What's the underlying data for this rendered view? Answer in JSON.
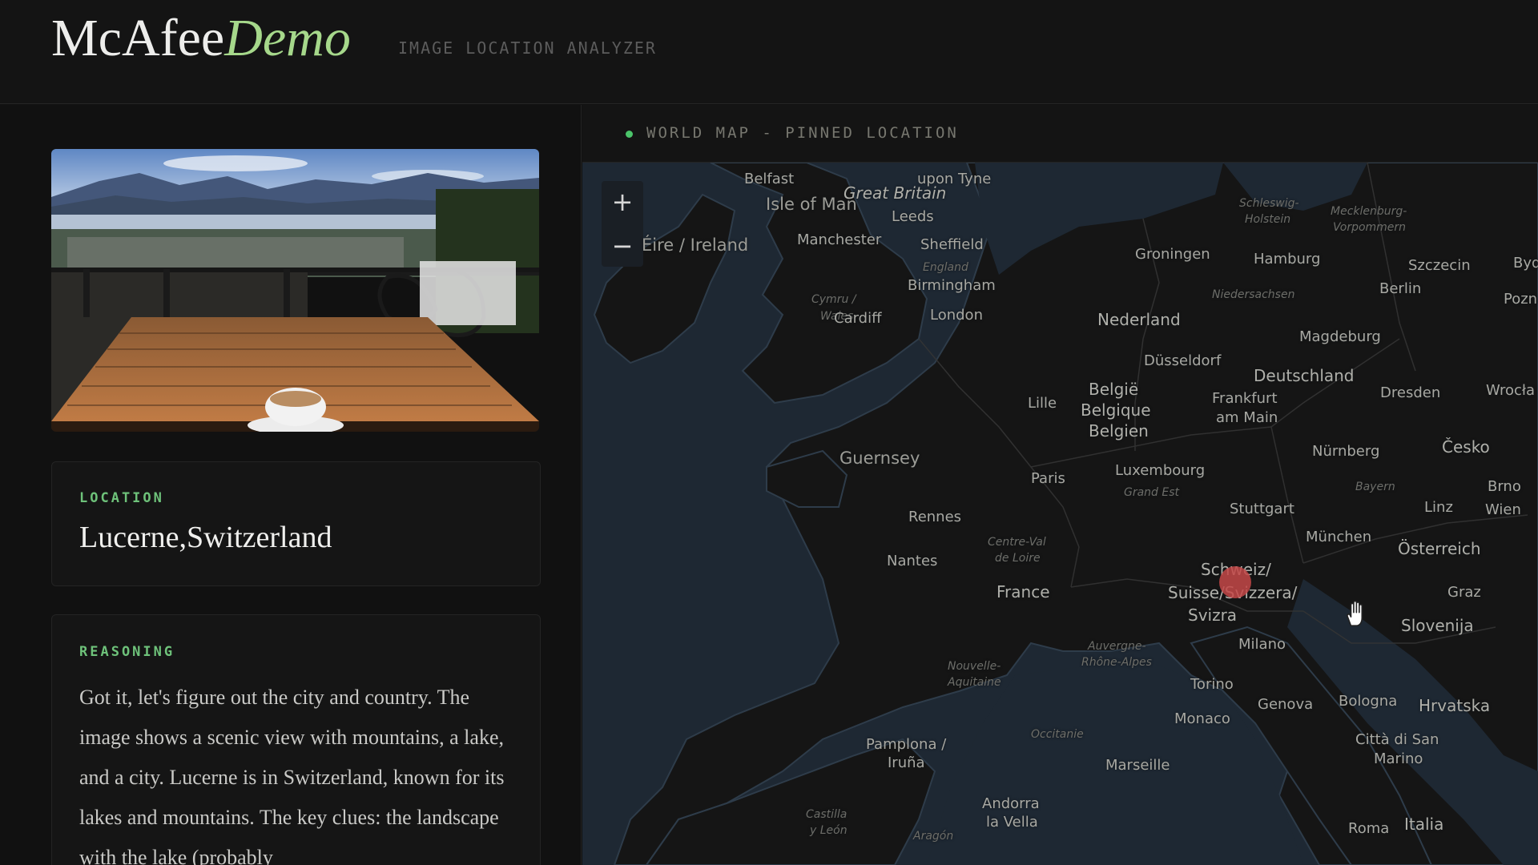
{
  "header": {
    "brand_main": "McAfee",
    "brand_accent": "Demo",
    "subtitle": "IMAGE LOCATION ANALYZER"
  },
  "location_card": {
    "label": "LOCATION",
    "value": "Lucerne,Switzerland"
  },
  "reasoning_card": {
    "label": "REASONING",
    "text": "Got it, let's figure out the city and country. The image shows a scenic view with mountains, a lake, and a city. Lucerne is in Switzerland, known for its lakes and mountains. The key clues: the landscape with the lake (probably"
  },
  "map": {
    "title": "WORLD MAP - PINNED LOCATION",
    "zoom_in": "+",
    "zoom_out": "−",
    "labels": {
      "belfast": "Belfast",
      "isle_of_man": "Isle of Man",
      "great_britain": "Great Britain",
      "upon_tyne": "upon Tyne",
      "leeds": "Leeds",
      "eire": "Éire / Ireland",
      "manchester": "Manchester",
      "sheffield": "Sheffield",
      "england": "England",
      "cymru": "Cymru /",
      "wales": "Wales",
      "birmingham": "Birmingham",
      "cardiff": "Cardiff",
      "london": "London",
      "guernsey": "Guernsey",
      "rennes": "Rennes",
      "nantes": "Nantes",
      "centre_val": "Centre-Val",
      "de_loire": "de Loire",
      "paris": "Paris",
      "france": "France",
      "lille": "Lille",
      "nederland": "Nederland",
      "groningen": "Groningen",
      "belgie": "België",
      "belgique": "Belgique",
      "belgien": "Belgien",
      "luxembourg": "Luxembourg",
      "grand_est": "Grand Est",
      "dusseldorf": "Düsseldorf",
      "frankfurt": "Frankfurt",
      "am_main": "am Main",
      "deutschland": "Deutschland",
      "hamburg": "Hamburg",
      "niedersachsen": "Niedersachsen",
      "berlin": "Berlin",
      "magdeburg": "Magdeburg",
      "dresden": "Dresden",
      "szczecin": "Szczecin",
      "schleswig": "Schleswig-",
      "holstein": "Holstein",
      "mecklenburg": "Mecklenburg-",
      "vorpommern": "Vorpommern",
      "nurnberg": "Nürnberg",
      "bayern": "Bayern",
      "stuttgart": "Stuttgart",
      "munchen": "München",
      "osterreich": "Österreich",
      "cesko": "Česko",
      "brno": "Brno",
      "linz": "Linz",
      "wien": "Wien",
      "graz": "Graz",
      "slovenija": "Slovenija",
      "hrvatska": "Hrvatska",
      "schweiz": "Schweiz/",
      "suisse": "Suisse/Svizzera/",
      "svizra": "Svizra",
      "milano": "Milano",
      "torino": "Torino",
      "genova": "Genova",
      "bologna": "Bologna",
      "monaco": "Monaco",
      "marseille": "Marseille",
      "auvergne": "Auvergne-",
      "rhone_alpes": "Rhône-Alpes",
      "nouvelle": "Nouvelle-",
      "aquitaine": "Aquitaine",
      "occitanie": "Occitanie",
      "pamplona": "Pamplona /",
      "iruna": "Iruña",
      "andorra": "Andorra",
      "la_vella": "la Vella",
      "castilla": "Castilla",
      "y_leon": "y León",
      "aragon": "Aragón",
      "citta": "Città di San",
      "marino": "Marino",
      "roma": "Roma",
      "italia": "Italia",
      "byd": "Byd",
      "pozna": "Pozna",
      "wrocla": "Wrocła"
    }
  },
  "colors": {
    "accent_green": "#a6d88b",
    "label_green": "#6ec27a",
    "pin_red": "#c44848",
    "map_water": "#1e2833",
    "map_land": "#151515"
  },
  "icons": {
    "status": "status-dot-icon",
    "pin": "location-pin-icon",
    "cursor": "hand-cursor-icon"
  }
}
